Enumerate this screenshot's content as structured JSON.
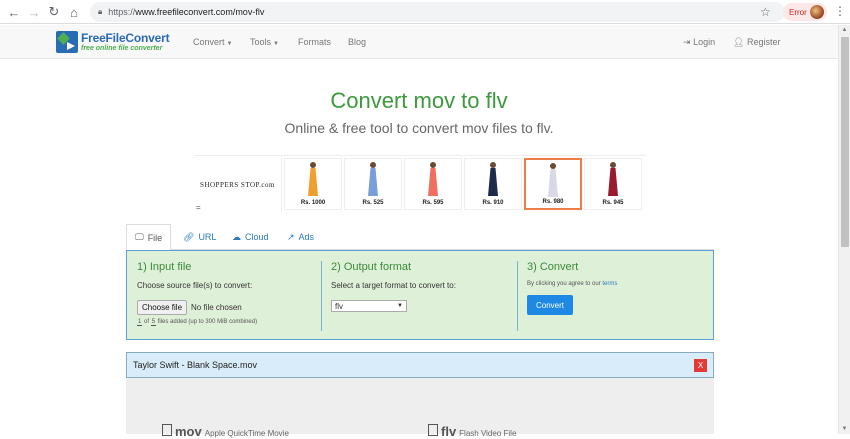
{
  "browser": {
    "url_scheme": "https://",
    "url_rest": "www.freefileconvert.com/mov-flv",
    "error_label": "Error"
  },
  "site": {
    "logo_main": "FreeFileConvert",
    "logo_sub": "free online file converter",
    "nav": [
      {
        "label": "Convert",
        "dropdown": true
      },
      {
        "label": "Tools",
        "dropdown": true
      },
      {
        "label": "Formats",
        "dropdown": false
      },
      {
        "label": "Blog",
        "dropdown": false
      }
    ],
    "login": "Login",
    "register": "Register"
  },
  "hero": {
    "title": "Convert mov to flv",
    "subtitle": "Online & free tool to convert mov files to flv."
  },
  "ad": {
    "brand": "SHOPPERS STOP.com",
    "eq": "=",
    "items": [
      {
        "price": "Rs. 1000",
        "color": "#f0a030"
      },
      {
        "price": "Rs. 525",
        "color": "#7a9fd8"
      },
      {
        "price": "Rs. 595",
        "color": "#f07060"
      },
      {
        "price": "Rs. 910",
        "color": "#1e2a4a"
      },
      {
        "price": "Rs. 980",
        "color": "#d8d8e8"
      },
      {
        "price": "Rs. 945",
        "color": "#9a1a30"
      }
    ]
  },
  "tabs": [
    {
      "label": "File",
      "icon": "monitor-icon"
    },
    {
      "label": "URL",
      "icon": "link-icon"
    },
    {
      "label": "Cloud",
      "icon": "cloud-icon"
    },
    {
      "label": "Ads",
      "icon": "external-link-icon"
    }
  ],
  "input": {
    "title": "1) Input file",
    "prompt": "Choose source file(s) to convert:",
    "choose_label": "Choose file",
    "no_file": "No file chosen",
    "count_current": "1",
    "count_of": "of",
    "count_max": "5",
    "count_suffix": "files added (up to 300 MiB combined)"
  },
  "output": {
    "title": "2) Output format",
    "prompt": "Select a target format to convert to:",
    "selected": "flv"
  },
  "convert": {
    "title": "3) Convert",
    "agree_text": "By clicking you agree to our",
    "terms_link": "terms",
    "button": "Convert"
  },
  "file": {
    "name": "Taylor Swift - Blank Space.mov",
    "close": "X"
  },
  "formats": {
    "source_ext": "mov",
    "source_desc": "Apple QuickTime Movie",
    "target_ext": "flv",
    "target_desc": "Flash Video File"
  }
}
